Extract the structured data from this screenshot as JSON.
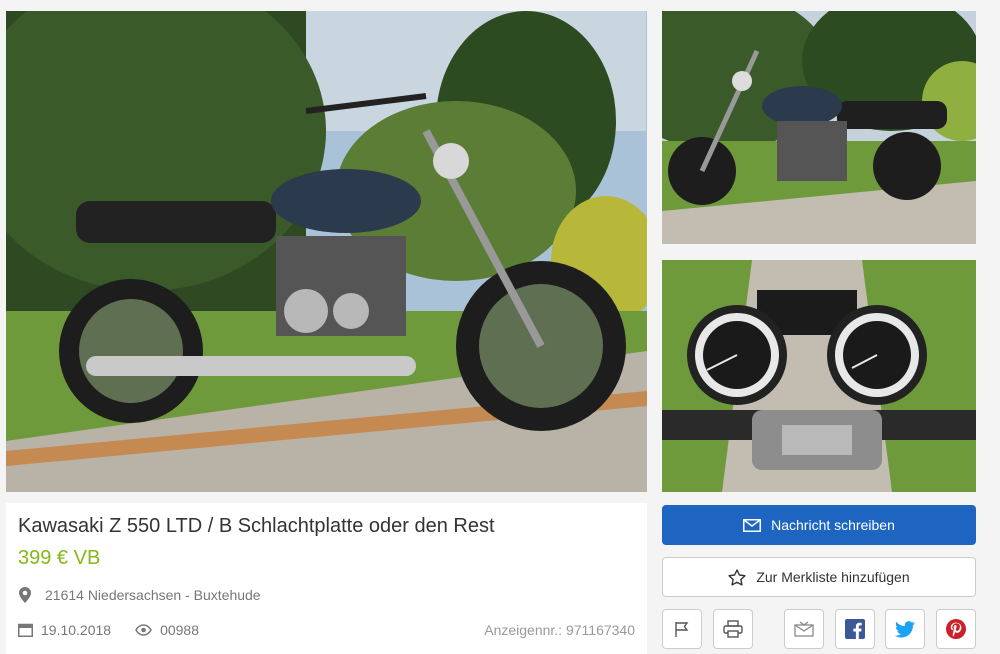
{
  "listing": {
    "title": "Kawasaki Z 550 LTD / B Schlachtplatte oder den Rest",
    "price": "399 € VB",
    "location": "21614 Niedersachsen - Buxtehude",
    "date": "19.10.2018",
    "views": "00988",
    "ad_number": "Anzeigennr.: 971167340"
  },
  "actions": {
    "message_label": "Nachricht schreiben",
    "watchlist_label": "Zur Merkliste hinzufügen"
  },
  "icons": {
    "location": "map-pin-icon",
    "date": "calendar-icon",
    "views": "eye-icon",
    "message": "envelope-icon",
    "watchlist": "star-icon",
    "report": "flag-icon",
    "print": "printer-icon",
    "email_share": "mail-share-icon",
    "facebook": "facebook-icon",
    "twitter": "twitter-icon",
    "pinterest": "pinterest-icon"
  },
  "colors": {
    "price": "#86b817",
    "primary_button": "#1d65c1",
    "facebook": "#3b5998",
    "twitter": "#1da1f2",
    "pinterest": "#cb2027"
  }
}
